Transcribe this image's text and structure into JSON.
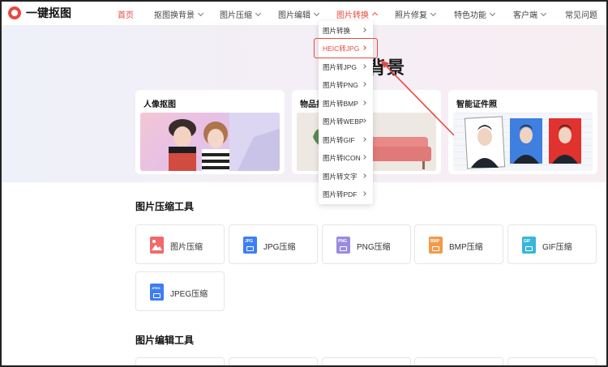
{
  "app": {
    "logo_text": "一键抠图",
    "accent_color": "#e8483f"
  },
  "nav": {
    "items": [
      {
        "label": "首页",
        "active": true
      },
      {
        "label": "抠图换背景"
      },
      {
        "label": "图片压缩"
      },
      {
        "label": "图片编辑"
      },
      {
        "label": "图片转换",
        "open": true
      },
      {
        "label": "照片修复"
      },
      {
        "label": "特色功能"
      },
      {
        "label": "客户端"
      },
      {
        "label": "常见问题"
      }
    ]
  },
  "banner": {
    "title_visible": "背景",
    "cards": [
      {
        "title": "人像抠图"
      },
      {
        "title": "物品抠"
      },
      {
        "title": "智能证件照"
      }
    ]
  },
  "dropdown": {
    "items": [
      "图片转换",
      "HEIC转JPG",
      "图片转JPG",
      "图片转PNG",
      "图片转BMP",
      "图片转WEBP",
      "图片转GIF",
      "图片转ICON",
      "图片转文字",
      "图片转PDF"
    ],
    "highlighted_index": 1
  },
  "compress_section": {
    "title": "图片压缩工具",
    "tools": [
      {
        "label": "图片压缩",
        "icon": "image-icon",
        "color": "#f06a6a"
      },
      {
        "label": "JPG压缩",
        "icon": "jpg-file-icon",
        "tag": "JPG",
        "color": "#3d7ef2"
      },
      {
        "label": "PNG压缩",
        "icon": "png-file-icon",
        "tag": "PNG",
        "color": "#9b8ae0"
      },
      {
        "label": "BMP压缩",
        "icon": "bmp-file-icon",
        "tag": "BMP",
        "color": "#f39a4a"
      },
      {
        "label": "GIF压缩",
        "icon": "gif-file-icon",
        "tag": "GIF",
        "color": "#39b6d8"
      },
      {
        "label": "JPEG压缩",
        "icon": "jpeg-file-icon",
        "tag": "JPEG",
        "color": "#3d7ef2"
      }
    ]
  },
  "edit_section": {
    "title": "图片编辑工具"
  }
}
